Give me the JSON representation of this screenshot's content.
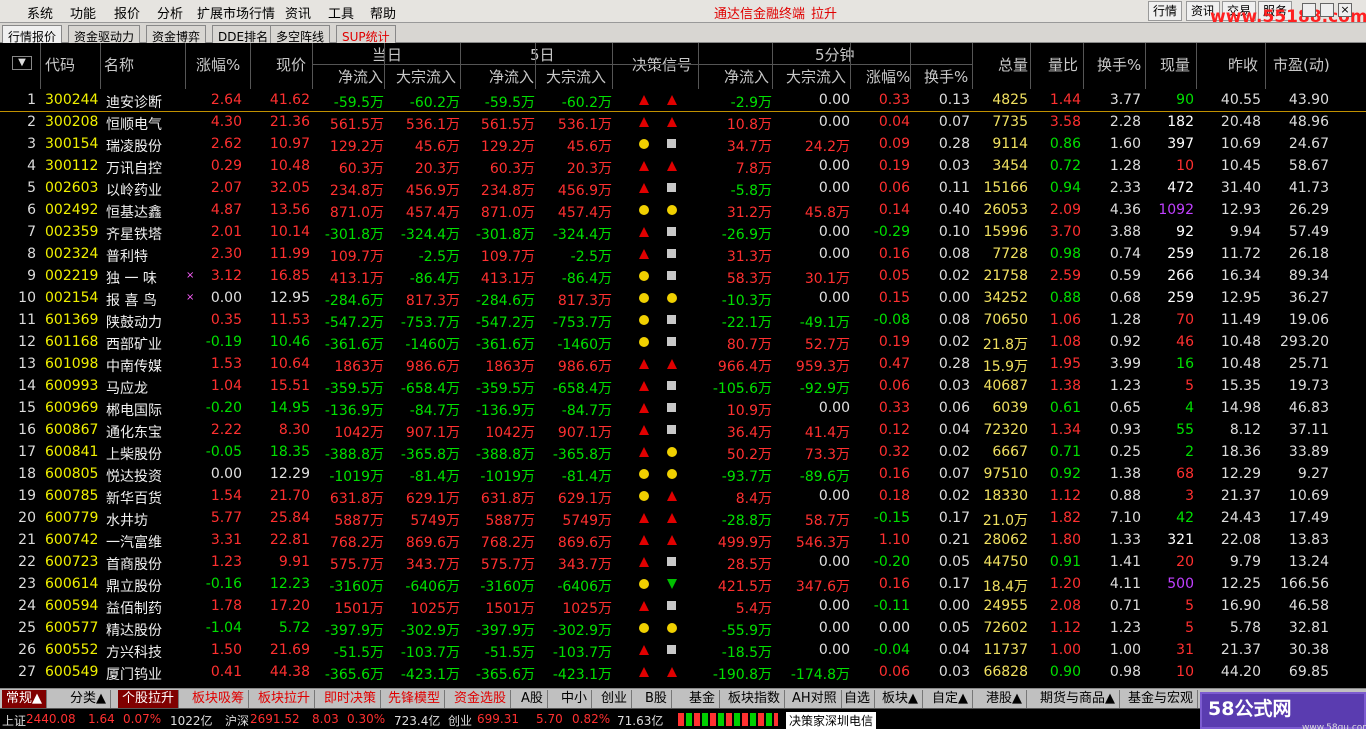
{
  "menu": [
    "系统",
    "功能",
    "报价",
    "分析",
    "扩展市场行情",
    "资讯",
    "工具",
    "帮助"
  ],
  "terminal_title": "通达信金融终端",
  "terminal_mode": "拉升",
  "right_buttons": [
    "行情",
    "资讯",
    "交易",
    "服务"
  ],
  "watermark": "www.55188.com",
  "tabs": [
    "行情报价",
    "资金驱动力",
    "资金博弈",
    "DDE排名",
    "多空阵线",
    "SUP统计"
  ],
  "header": {
    "sort": "▼",
    "code": "代码",
    "name": "名称",
    "change": "涨幅%",
    "price": "现价",
    "group_day": "当日",
    "group_5d": "5日",
    "signal": "决策信号",
    "group_5m": "5分钟",
    "net": "净流入",
    "block": "大宗流入",
    "chg": "涨幅%",
    "turn": "换手%",
    "total": "总量",
    "ratio": "量比",
    "turnover": "换手%",
    "vol": "现量",
    "prev": "昨收",
    "pe": "市盈(动)"
  },
  "rows": [
    {
      "n": "1",
      "code": "300244",
      "name": "迪安诊断",
      "x": "",
      "chg": "2.64",
      "price": "41.62",
      "dn": "-59.5万",
      "db": "-60.2万",
      "fn": "-59.5万",
      "fb": "-60.2万",
      "s1": "up",
      "s2": "up",
      "mn": "-2.9万",
      "mb": "0.00",
      "mc": "0.33",
      "mt": "0.13",
      "tot": "4825",
      "vr": "1.44",
      "to": "3.77",
      "cv": "90",
      "pc": "40.55",
      "pe": "43.90"
    },
    {
      "n": "2",
      "code": "300208",
      "name": "恒顺电气",
      "x": "",
      "chg": "4.30",
      "price": "21.36",
      "dn": "561.5万",
      "db": "536.1万",
      "fn": "561.5万",
      "fb": "536.1万",
      "s1": "up",
      "s2": "up",
      "mn": "10.8万",
      "mb": "0.00",
      "mc": "0.04",
      "mt": "0.07",
      "tot": "7735",
      "vr": "3.58",
      "to": "2.28",
      "cv": "182",
      "pc": "20.48",
      "pe": "48.96"
    },
    {
      "n": "3",
      "code": "300154",
      "name": "瑞凌股份",
      "x": "",
      "chg": "2.62",
      "price": "10.97",
      "dn": "129.2万",
      "db": "45.6万",
      "fn": "129.2万",
      "fb": "45.6万",
      "s1": "dot",
      "s2": "sq",
      "mn": "34.7万",
      "mb": "24.2万",
      "mc": "0.09",
      "mt": "0.28",
      "tot": "9114",
      "vr": "0.86",
      "to": "1.60",
      "cv": "397",
      "pc": "10.69",
      "pe": "24.67"
    },
    {
      "n": "4",
      "code": "300112",
      "name": "万讯自控",
      "x": "",
      "chg": "0.29",
      "price": "10.48",
      "dn": "60.3万",
      "db": "20.3万",
      "fn": "60.3万",
      "fb": "20.3万",
      "s1": "up",
      "s2": "up",
      "mn": "7.8万",
      "mb": "0.00",
      "mc": "0.19",
      "mt": "0.03",
      "tot": "3454",
      "vr": "0.72",
      "to": "1.28",
      "cv": "10",
      "pc": "10.45",
      "pe": "58.67"
    },
    {
      "n": "5",
      "code": "002603",
      "name": "以岭药业",
      "x": "",
      "chg": "2.07",
      "price": "32.05",
      "dn": "234.8万",
      "db": "456.9万",
      "fn": "234.8万",
      "fb": "456.9万",
      "s1": "up",
      "s2": "sq",
      "mn": "-5.8万",
      "mb": "0.00",
      "mc": "0.06",
      "mt": "0.11",
      "tot": "15166",
      "vr": "0.94",
      "to": "2.33",
      "cv": "472",
      "pc": "31.40",
      "pe": "41.73"
    },
    {
      "n": "6",
      "code": "002492",
      "name": "恒基达鑫",
      "x": "",
      "chg": "4.87",
      "price": "13.56",
      "dn": "871.0万",
      "db": "457.4万",
      "fn": "871.0万",
      "fb": "457.4万",
      "s1": "dot",
      "s2": "dot",
      "mn": "31.2万",
      "mb": "45.8万",
      "mc": "0.14",
      "mt": "0.40",
      "tot": "26053",
      "vr": "2.09",
      "to": "4.36",
      "cv": "1092",
      "pc": "12.93",
      "pe": "26.29"
    },
    {
      "n": "7",
      "code": "002359",
      "name": "齐星铁塔",
      "x": "",
      "chg": "2.01",
      "price": "10.14",
      "dn": "-301.8万",
      "db": "-324.4万",
      "fn": "-301.8万",
      "fb": "-324.4万",
      "s1": "up",
      "s2": "sq",
      "mn": "-26.9万",
      "mb": "0.00",
      "mc": "-0.29",
      "mt": "0.10",
      "tot": "15996",
      "vr": "3.70",
      "to": "3.88",
      "cv": "92",
      "pc": "9.94",
      "pe": "57.49"
    },
    {
      "n": "8",
      "code": "002324",
      "name": "普利特",
      "x": "",
      "chg": "2.30",
      "price": "11.99",
      "dn": "109.7万",
      "db": "-2.5万",
      "fn": "109.7万",
      "fb": "-2.5万",
      "s1": "up",
      "s2": "sq",
      "mn": "31.3万",
      "mb": "0.00",
      "mc": "0.16",
      "mt": "0.08",
      "tot": "7728",
      "vr": "0.98",
      "to": "0.74",
      "cv": "259",
      "pc": "11.72",
      "pe": "26.18"
    },
    {
      "n": "9",
      "code": "002219",
      "name": "独 一 味",
      "x": "×",
      "chg": "3.12",
      "price": "16.85",
      "dn": "413.1万",
      "db": "-86.4万",
      "fn": "413.1万",
      "fb": "-86.4万",
      "s1": "dot",
      "s2": "sq",
      "mn": "58.3万",
      "mb": "30.1万",
      "mc": "0.05",
      "mt": "0.02",
      "tot": "21758",
      "vr": "2.59",
      "to": "0.59",
      "cv": "266",
      "pc": "16.34",
      "pe": "89.34"
    },
    {
      "n": "10",
      "code": "002154",
      "name": "报 喜 鸟",
      "x": "×",
      "chg": "0.00",
      "price": "12.95",
      "dn": "-284.6万",
      "db": "817.3万",
      "fn": "-284.6万",
      "fb": "817.3万",
      "s1": "dot",
      "s2": "dot",
      "mn": "-10.3万",
      "mb": "0.00",
      "mc": "0.15",
      "mt": "0.00",
      "tot": "34252",
      "vr": "0.88",
      "to": "0.68",
      "cv": "259",
      "pc": "12.95",
      "pe": "36.27"
    },
    {
      "n": "11",
      "code": "601369",
      "name": "陕鼓动力",
      "x": "",
      "chg": "0.35",
      "price": "11.53",
      "dn": "-547.2万",
      "db": "-753.7万",
      "fn": "-547.2万",
      "fb": "-753.7万",
      "s1": "dot",
      "s2": "sq",
      "mn": "-22.1万",
      "mb": "-49.1万",
      "mc": "-0.08",
      "mt": "0.08",
      "tot": "70650",
      "vr": "1.06",
      "to": "1.28",
      "cv": "70",
      "pc": "11.49",
      "pe": "19.06"
    },
    {
      "n": "12",
      "code": "601168",
      "name": "西部矿业",
      "x": "",
      "chg": "-0.19",
      "price": "10.46",
      "dn": "-361.6万",
      "db": "-1460万",
      "fn": "-361.6万",
      "fb": "-1460万",
      "s1": "dot",
      "s2": "sq",
      "mn": "80.7万",
      "mb": "52.7万",
      "mc": "0.19",
      "mt": "0.02",
      "tot": "21.8万",
      "vr": "1.08",
      "to": "0.92",
      "cv": "46",
      "pc": "10.48",
      "pe": "293.20"
    },
    {
      "n": "13",
      "code": "601098",
      "name": "中南传媒",
      "x": "",
      "chg": "1.53",
      "price": "10.64",
      "dn": "1863万",
      "db": "986.6万",
      "fn": "1863万",
      "fb": "986.6万",
      "s1": "up",
      "s2": "up",
      "mn": "966.4万",
      "mb": "959.3万",
      "mc": "0.47",
      "mt": "0.28",
      "tot": "15.9万",
      "vr": "1.95",
      "to": "3.99",
      "cv": "16",
      "pc": "10.48",
      "pe": "25.71"
    },
    {
      "n": "14",
      "code": "600993",
      "name": "马应龙",
      "x": "",
      "chg": "1.04",
      "price": "15.51",
      "dn": "-359.5万",
      "db": "-658.4万",
      "fn": "-359.5万",
      "fb": "-658.4万",
      "s1": "up",
      "s2": "sq",
      "mn": "-105.6万",
      "mb": "-92.9万",
      "mc": "0.06",
      "mt": "0.03",
      "tot": "40687",
      "vr": "1.38",
      "to": "1.23",
      "cv": "5",
      "pc": "15.35",
      "pe": "19.73"
    },
    {
      "n": "15",
      "code": "600969",
      "name": "郴电国际",
      "x": "",
      "chg": "-0.20",
      "price": "14.95",
      "dn": "-136.9万",
      "db": "-84.7万",
      "fn": "-136.9万",
      "fb": "-84.7万",
      "s1": "up",
      "s2": "sq",
      "mn": "10.9万",
      "mb": "0.00",
      "mc": "0.33",
      "mt": "0.06",
      "tot": "6039",
      "vr": "0.61",
      "to": "0.65",
      "cv": "4",
      "pc": "14.98",
      "pe": "46.83"
    },
    {
      "n": "16",
      "code": "600867",
      "name": "通化东宝",
      "x": "",
      "chg": "2.22",
      "price": "8.30",
      "dn": "1042万",
      "db": "907.1万",
      "fn": "1042万",
      "fb": "907.1万",
      "s1": "up",
      "s2": "sq",
      "mn": "36.4万",
      "mb": "41.4万",
      "mc": "0.12",
      "mt": "0.04",
      "tot": "72320",
      "vr": "1.34",
      "to": "0.93",
      "cv": "55",
      "pc": "8.12",
      "pe": "37.11"
    },
    {
      "n": "17",
      "code": "600841",
      "name": "上柴股份",
      "x": "",
      "chg": "-0.05",
      "price": "18.35",
      "dn": "-388.8万",
      "db": "-365.8万",
      "fn": "-388.8万",
      "fb": "-365.8万",
      "s1": "up",
      "s2": "dot",
      "mn": "50.2万",
      "mb": "73.3万",
      "mc": "0.32",
      "mt": "0.02",
      "tot": "6667",
      "vr": "0.71",
      "to": "0.25",
      "cv": "2",
      "pc": "18.36",
      "pe": "33.89"
    },
    {
      "n": "18",
      "code": "600805",
      "name": "悦达投资",
      "x": "",
      "chg": "0.00",
      "price": "12.29",
      "dn": "-1019万",
      "db": "-81.4万",
      "fn": "-1019万",
      "fb": "-81.4万",
      "s1": "dot",
      "s2": "dot",
      "mn": "-93.7万",
      "mb": "-89.6万",
      "mc": "0.16",
      "mt": "0.07",
      "tot": "97510",
      "vr": "0.92",
      "to": "1.38",
      "cv": "68",
      "pc": "12.29",
      "pe": "9.27"
    },
    {
      "n": "19",
      "code": "600785",
      "name": "新华百货",
      "x": "",
      "chg": "1.54",
      "price": "21.70",
      "dn": "631.8万",
      "db": "629.1万",
      "fn": "631.8万",
      "fb": "629.1万",
      "s1": "dot",
      "s2": "up",
      "mn": "8.4万",
      "mb": "0.00",
      "mc": "0.18",
      "mt": "0.02",
      "tot": "18330",
      "vr": "1.12",
      "to": "0.88",
      "cv": "3",
      "pc": "21.37",
      "pe": "10.69"
    },
    {
      "n": "20",
      "code": "600779",
      "name": "水井坊",
      "x": "",
      "chg": "5.77",
      "price": "25.84",
      "dn": "5887万",
      "db": "5749万",
      "fn": "5887万",
      "fb": "5749万",
      "s1": "up",
      "s2": "up",
      "mn": "-28.8万",
      "mb": "58.7万",
      "mc": "-0.15",
      "mt": "0.17",
      "tot": "21.0万",
      "vr": "1.82",
      "to": "7.10",
      "cv": "42",
      "pc": "24.43",
      "pe": "17.49"
    },
    {
      "n": "21",
      "code": "600742",
      "name": "一汽富维",
      "x": "",
      "chg": "3.31",
      "price": "22.81",
      "dn": "768.2万",
      "db": "869.6万",
      "fn": "768.2万",
      "fb": "869.6万",
      "s1": "up",
      "s2": "up",
      "mn": "499.9万",
      "mb": "546.3万",
      "mc": "1.10",
      "mt": "0.21",
      "tot": "28062",
      "vr": "1.80",
      "to": "1.33",
      "cv": "321",
      "pc": "22.08",
      "pe": "13.83"
    },
    {
      "n": "22",
      "code": "600723",
      "name": "首商股份",
      "x": "",
      "chg": "1.23",
      "price": "9.91",
      "dn": "575.7万",
      "db": "343.7万",
      "fn": "575.7万",
      "fb": "343.7万",
      "s1": "up",
      "s2": "sq",
      "mn": "28.5万",
      "mb": "0.00",
      "mc": "-0.20",
      "mt": "0.05",
      "tot": "44750",
      "vr": "0.91",
      "to": "1.41",
      "cv": "20",
      "pc": "9.79",
      "pe": "13.24"
    },
    {
      "n": "23",
      "code": "600614",
      "name": "鼎立股份",
      "x": "",
      "chg": "-0.16",
      "price": "12.23",
      "dn": "-3160万",
      "db": "-6406万",
      "fn": "-3160万",
      "fb": "-6406万",
      "s1": "dot",
      "s2": "down",
      "mn": "421.5万",
      "mb": "347.6万",
      "mc": "0.16",
      "mt": "0.17",
      "tot": "18.4万",
      "vr": "1.20",
      "to": "4.11",
      "cv": "500",
      "pc": "12.25",
      "pe": "166.56"
    },
    {
      "n": "24",
      "code": "600594",
      "name": "益佰制药",
      "x": "",
      "chg": "1.78",
      "price": "17.20",
      "dn": "1501万",
      "db": "1025万",
      "fn": "1501万",
      "fb": "1025万",
      "s1": "up",
      "s2": "sq",
      "mn": "5.4万",
      "mb": "0.00",
      "mc": "-0.11",
      "mt": "0.00",
      "tot": "24955",
      "vr": "2.08",
      "to": "0.71",
      "cv": "5",
      "pc": "16.90",
      "pe": "46.58"
    },
    {
      "n": "25",
      "code": "600577",
      "name": "精达股份",
      "x": "",
      "chg": "-1.04",
      "price": "5.72",
      "dn": "-397.9万",
      "db": "-302.9万",
      "fn": "-397.9万",
      "fb": "-302.9万",
      "s1": "dot",
      "s2": "dot",
      "mn": "-55.9万",
      "mb": "0.00",
      "mc": "0.00",
      "mt": "0.05",
      "tot": "72602",
      "vr": "1.12",
      "to": "1.23",
      "cv": "5",
      "pc": "5.78",
      "pe": "32.81"
    },
    {
      "n": "26",
      "code": "600552",
      "name": "方兴科技",
      "x": "",
      "chg": "1.50",
      "price": "21.69",
      "dn": "-51.5万",
      "db": "-103.7万",
      "fn": "-51.5万",
      "fb": "-103.7万",
      "s1": "up",
      "s2": "sq",
      "mn": "-18.5万",
      "mb": "0.00",
      "mc": "-0.04",
      "mt": "0.04",
      "tot": "11737",
      "vr": "1.00",
      "to": "1.00",
      "cv": "31",
      "pc": "21.37",
      "pe": "30.38"
    },
    {
      "n": "27",
      "code": "600549",
      "name": "厦门钨业",
      "x": "",
      "chg": "0.41",
      "price": "44.38",
      "dn": "-365.6万",
      "db": "-423.1万",
      "fn": "-365.6万",
      "fb": "-423.1万",
      "s1": "up",
      "s2": "up",
      "mn": "-190.8万",
      "mb": "-174.8万",
      "mc": "0.06",
      "mt": "0.03",
      "tot": "66828",
      "vr": "0.90",
      "to": "0.98",
      "cv": "10",
      "pc": "44.20",
      "pe": "69.85"
    }
  ],
  "bottom_tabs": [
    "常规▲",
    "分类▲",
    "个股拉升",
    "板块吸筹",
    "板块拉升",
    "即时决策",
    "先锋模型",
    "资金选股",
    "A股",
    "中小",
    "创业",
    "B股",
    "基金",
    "板块指数",
    "AH对照",
    "自选",
    "板块▲",
    "自定▲",
    "港股▲",
    "期货与商品▲",
    "基金与宏观"
  ],
  "status": {
    "sh_label": "上证",
    "sh_val": "2440.08",
    "sh_chg": "1.64",
    "sh_pct": "0.07%",
    "sh_amt": "1022亿",
    "hs_label": "沪深",
    "hs_val": "2691.52",
    "hs_chg": "8.03",
    "hs_pct": "0.30%",
    "hs_amt": "723.4亿",
    "cy_label": "创业",
    "cy_val": "699.31",
    "cy_chg": "5.70",
    "cy_pct": "0.82%",
    "cy_amt": "71.63亿",
    "info": "决策家深圳电信"
  },
  "logo": {
    "text": "58公式网",
    "url": "www.58gu.com"
  },
  "colors": {
    "up": "#ff3030",
    "down": "#00e000",
    "flat": "#e0e0e0",
    "code": "#f0f000",
    "total": "#f0e060",
    "purple": "#c040ff"
  }
}
